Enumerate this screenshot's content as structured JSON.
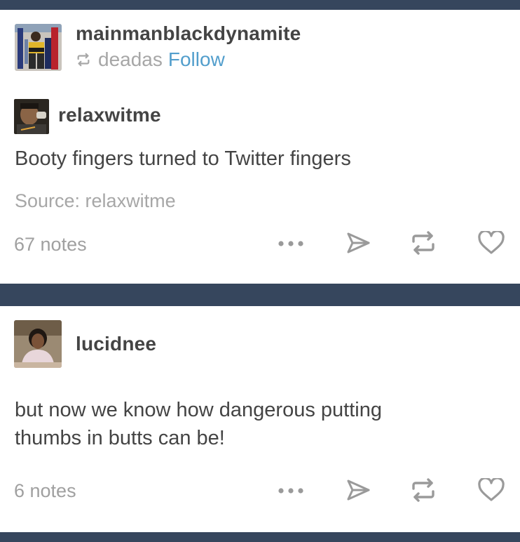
{
  "posts": [
    {
      "reblogger": "mainmanblackdynamite",
      "reblogged_from": "deadas",
      "follow_label": "Follow",
      "original_author": "relaxwitme",
      "body": "Booty fingers turned to Twitter fingers",
      "source": "Source: relaxwitme",
      "notes": "67 notes"
    },
    {
      "author": "lucidnee",
      "body_lines": [
        "but now we know how dangerous putting",
        "thumbs in butts can be!"
      ],
      "notes": "6 notes"
    }
  ],
  "icons": {
    "reblog_small": "reblog-icon",
    "more": "more-options-icon",
    "share": "share-icon",
    "reblog": "reblog-icon",
    "like": "heart-icon"
  },
  "colors": {
    "background": "#36465d",
    "card": "#ffffff",
    "username": "#444444",
    "muted": "#a7a7a7",
    "follow": "#529ecc"
  }
}
